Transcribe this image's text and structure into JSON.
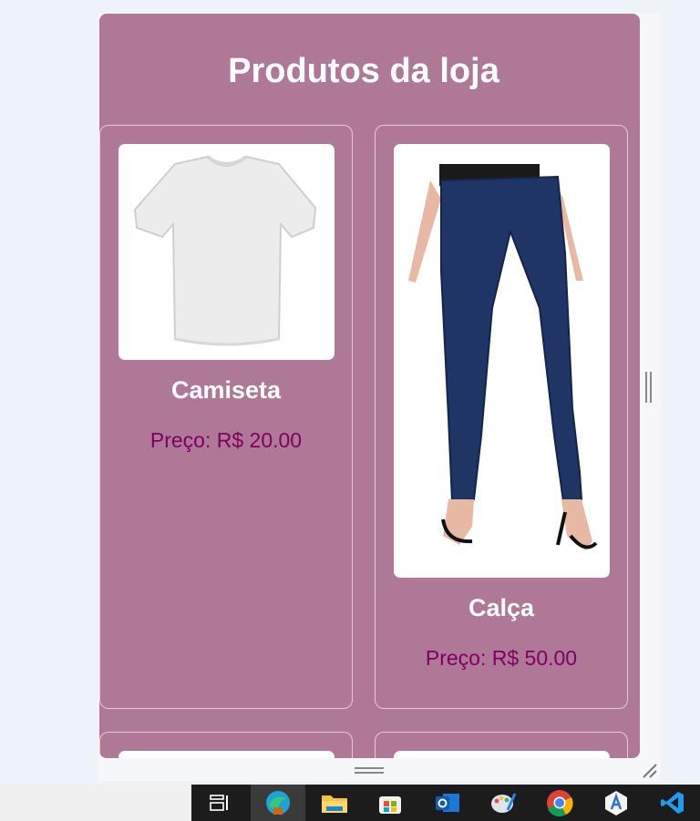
{
  "page": {
    "title": "Produtos da loja"
  },
  "products": [
    {
      "name": "Camiseta",
      "price": "Preço: R$ 20.00",
      "image": "white-tshirt"
    },
    {
      "name": "Calça",
      "price": "Preço: R$ 50.00",
      "image": "blue-jeans"
    }
  ],
  "taskbar": {
    "icons": [
      "task-view-icon",
      "edge-icon",
      "file-explorer-icon",
      "microsoft-store-icon",
      "outlook-icon",
      "paint-icon",
      "chrome-icon",
      "app-installer-icon",
      "vscode-icon"
    ]
  },
  "colors": {
    "shop_bg": "#af7896",
    "price_text": "#800060",
    "title_text": "#ffffff"
  }
}
